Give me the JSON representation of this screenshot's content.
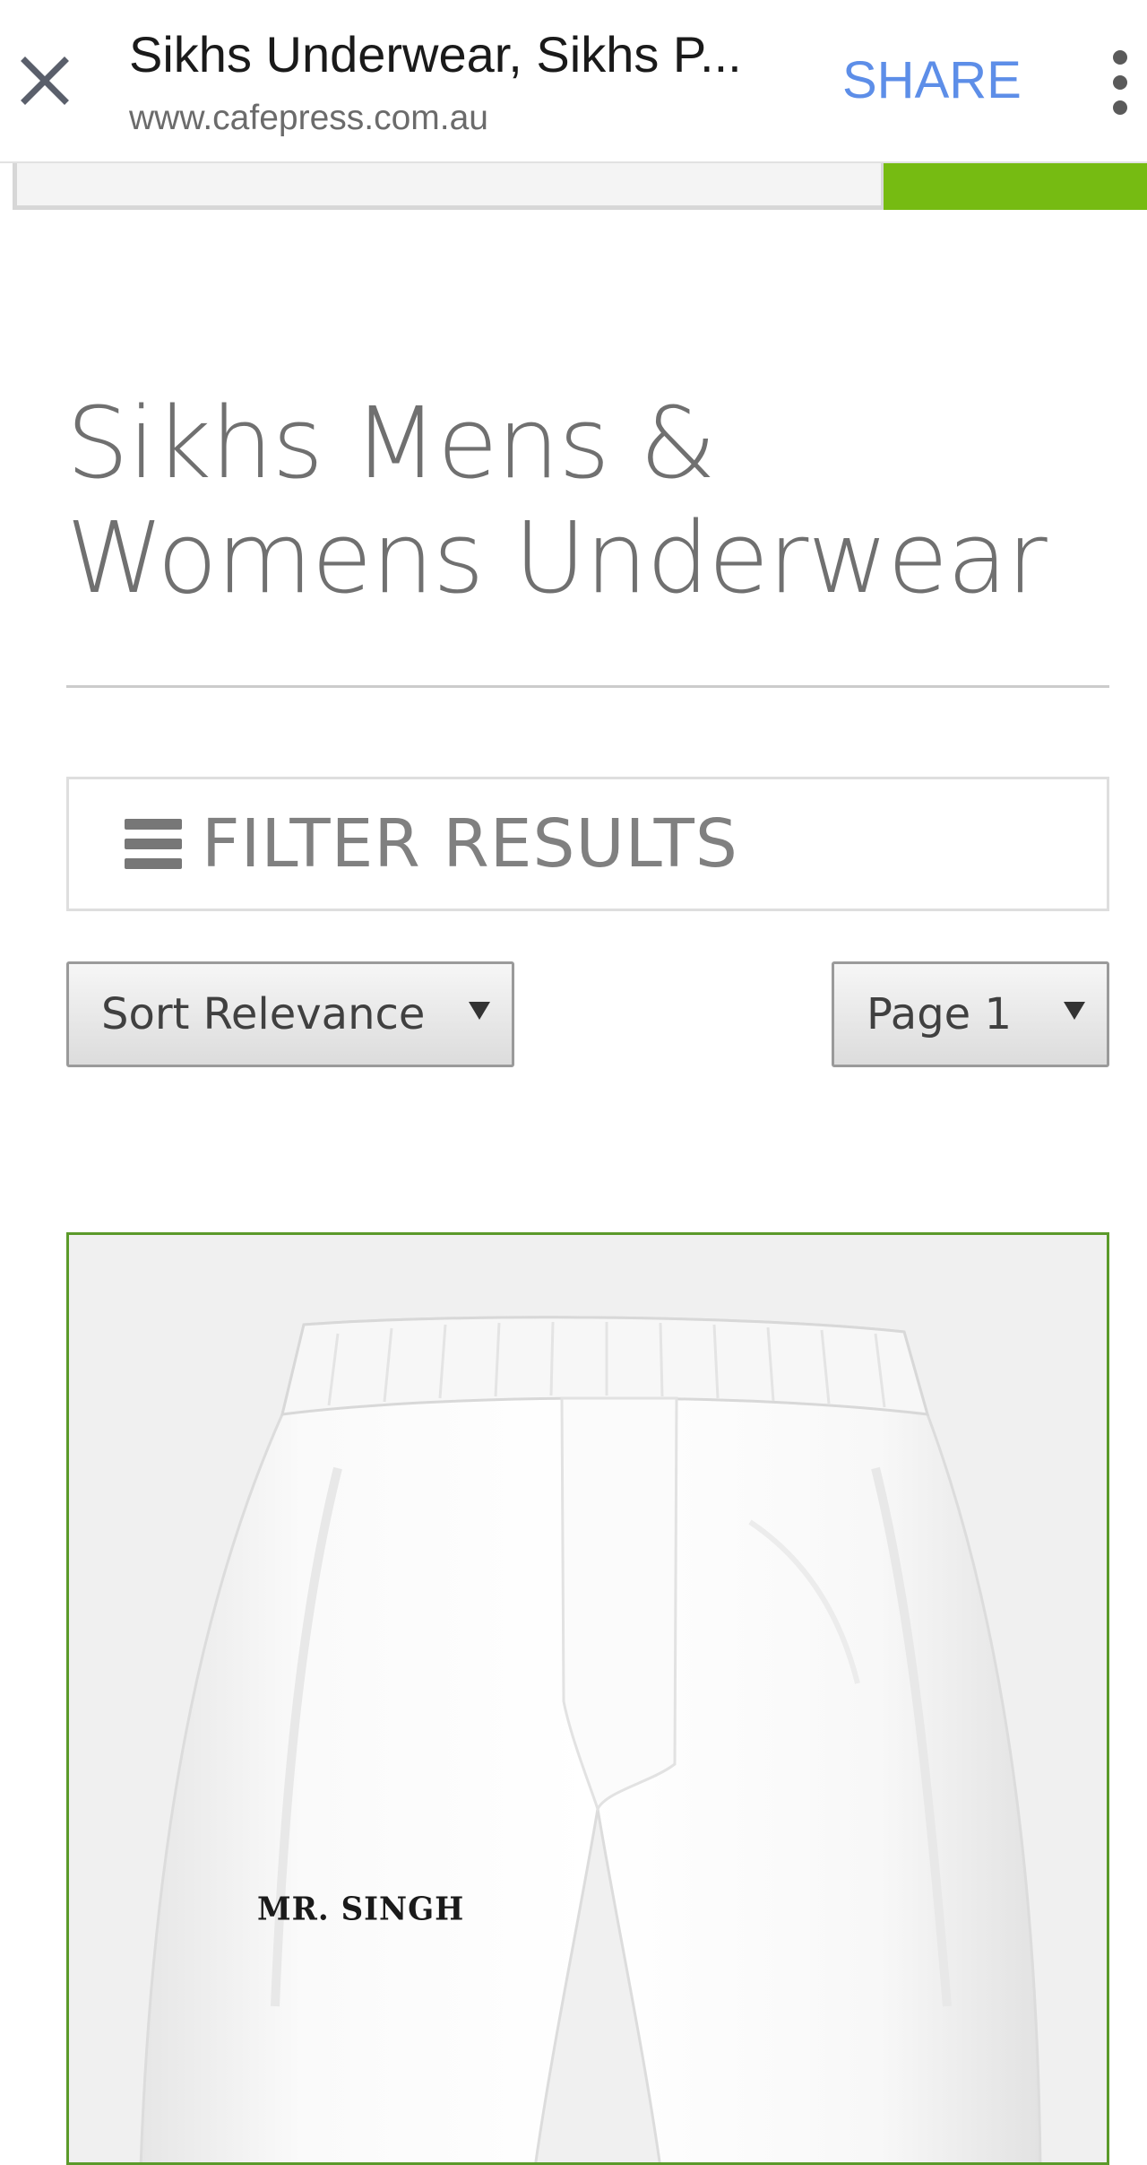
{
  "topbar": {
    "title": "Sikhs Underwear, Sikhs P...",
    "url": "www.cafepress.com.au",
    "share_label": "SHARE"
  },
  "search": {
    "value": ""
  },
  "heading": {
    "line1": "Sikhs Mens &",
    "line2": "Womens Underwear"
  },
  "filter": {
    "label": "FILTER RESULTS"
  },
  "sort": {
    "selected": "Sort Relevance"
  },
  "pagination": {
    "selected": "Page 1"
  },
  "products": [
    {
      "print_text": "MR. SINGH"
    }
  ],
  "colors": {
    "accent_green": "#76bb12",
    "card_border": "#5b9a2a",
    "share_blue": "#5d8ee8"
  },
  "icons": [
    "close-icon",
    "more-vert-icon",
    "hamburger-icon",
    "dropdown-arrow-icon"
  ]
}
